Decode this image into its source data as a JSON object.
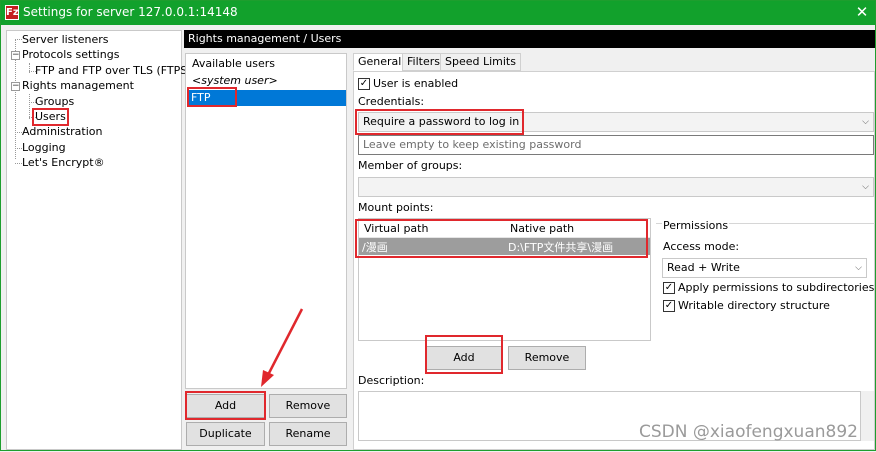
{
  "window": {
    "title": "Settings for server 127.0.0.1:14148",
    "close_glyph": "✕",
    "app_icon": "Fz"
  },
  "tree": {
    "items": [
      {
        "label": "Server listeners"
      },
      {
        "label": "Protocols settings",
        "expander": "−"
      },
      {
        "label": "FTP and FTP over TLS (FTPS)"
      },
      {
        "label": "Rights management",
        "expander": "−"
      },
      {
        "label": "Groups"
      },
      {
        "label": "Users",
        "selected": true
      },
      {
        "label": "Administration"
      },
      {
        "label": "Logging"
      },
      {
        "label": "Let's Encrypt®"
      }
    ]
  },
  "header": {
    "title": "Rights management / Users"
  },
  "users": {
    "label": "Available users",
    "system_user": "<system user>",
    "selected_user": "FTP",
    "buttons": {
      "add": "Add",
      "remove": "Remove",
      "duplicate": "Duplicate",
      "rename": "Rename"
    }
  },
  "tabs": [
    {
      "label": "General",
      "active": true
    },
    {
      "label": "Filters"
    },
    {
      "label": "Speed Limits"
    }
  ],
  "general": {
    "user_enabled": {
      "checked": true,
      "label": "User is enabled"
    },
    "credentials_label": "Credentials:",
    "credentials_value": "Require a password to log in",
    "password_placeholder": "Leave empty to keep existing password",
    "groups_label": "Member of groups:",
    "groups_value": "",
    "mount_label": "Mount points:",
    "mount_headers": {
      "virtual": "Virtual path",
      "native": "Native path"
    },
    "mount_rows": [
      {
        "virtual": "/漫画",
        "native": "D:\\FTP文件共享\\漫画"
      }
    ],
    "mount_buttons": {
      "add": "Add",
      "remove": "Remove"
    },
    "description_label": "Description:"
  },
  "permissions": {
    "title": "Permissions",
    "access_label": "Access mode:",
    "access_value": "Read + Write",
    "apply_sub": {
      "checked": true,
      "label": "Apply permissions to subdirectories"
    },
    "writable": {
      "checked": true,
      "label": "Writable directory structure"
    }
  },
  "watermark": "CSDN @xiaofengxuan892",
  "colors": {
    "title_bar": "#12a12c",
    "selection": "#0078d7",
    "highlight": "#e0282d",
    "header": "#000000"
  }
}
